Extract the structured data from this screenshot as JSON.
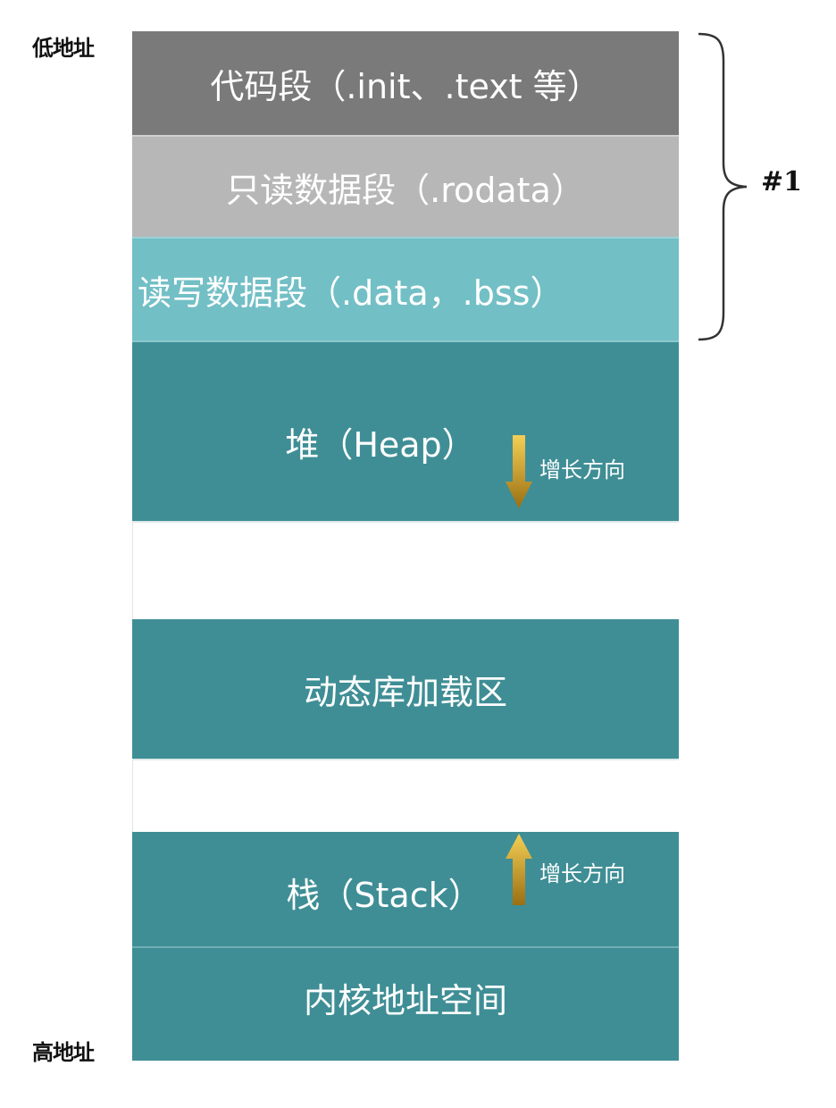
{
  "address_labels": {
    "low": "低地址",
    "high": "高地址"
  },
  "segments": [
    {
      "label": "代码段（.init、.text 等）"
    },
    {
      "label": "只读数据段（.rodata）"
    },
    {
      "label": "读写数据段（.data，.bss）"
    },
    {
      "label": "堆（Heap）"
    },
    {
      "label": ""
    },
    {
      "label": "动态库加载区"
    },
    {
      "label": ""
    },
    {
      "label": "栈（Stack）"
    },
    {
      "label": "内核地址空间"
    }
  ],
  "growth": {
    "heap": {
      "label": "增长方向",
      "direction": "down",
      "icon": "down-arrow-icon"
    },
    "stack": {
      "label": "增长方向",
      "direction": "up",
      "icon": "up-arrow-icon"
    }
  },
  "group": {
    "label": "#1",
    "spans_segments": [
      0,
      1,
      2
    ]
  },
  "colors": {
    "code": "#7a7a7a",
    "rodata": "#b7b7b7",
    "rwdata": "#73bfc6",
    "teal": "#3f8e95",
    "arrow": "#e3b22f"
  }
}
